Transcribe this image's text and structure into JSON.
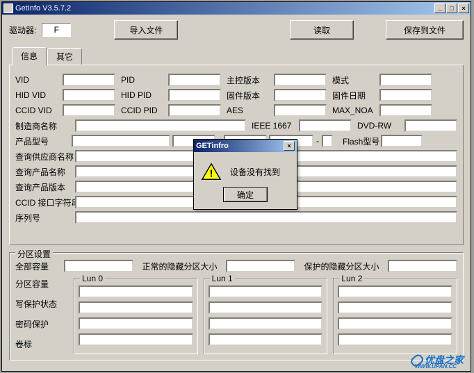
{
  "window": {
    "title": "GetInfo V3.5.7.2",
    "minimize": "_",
    "maximize": "□",
    "close": "×"
  },
  "top": {
    "drive_label": "驱动器:",
    "drive_value": "F",
    "import_btn": "导入文件",
    "read_btn": "读取",
    "save_btn": "保存到文件"
  },
  "tabs": {
    "info": "信息",
    "other": "其它"
  },
  "fields": {
    "vid": "VID",
    "pid": "PID",
    "ctrl_ver": "主控版本",
    "mode": "模式",
    "hid_vid": "HID VID",
    "hid_pid": "HID PID",
    "fw_ver": "固件版本",
    "fw_date": "固件日期",
    "ccid_vid": "CCID VID",
    "ccid_pid": "CCID PID",
    "aes": "AES",
    "max_noa": "MAX_NOA",
    "mfr": "制造商名称",
    "ieee": "IEEE 1667",
    "dvdrw": "DVD-RW",
    "prod_model": "产品型号",
    "flash_model": "Flash型号",
    "q_vendor": "查询供应商名称",
    "q_product": "查询产品名称",
    "q_version": "查询产品版本",
    "ccid_str": "CCID 接口字符串",
    "serial": "序列号"
  },
  "partition": {
    "title": "分区设置",
    "total_cap": "全部容量",
    "normal_hidden": "正常的隐藏分区大小",
    "protected_hidden": "保护的隐藏分区大小",
    "lun0": "Lun 0",
    "lun1": "Lun 1",
    "lun2": "Lun 2",
    "part_cap": "分区容量",
    "wp_state": "写保护状态",
    "pwd_protect": "密码保护",
    "volume": "卷标"
  },
  "dialog": {
    "title": "GETinfro",
    "message": "设备没有找到",
    "ok": "确定",
    "close": "×"
  },
  "watermark": {
    "text": "优盘之家",
    "url": "WWW.UPAN.CC"
  }
}
